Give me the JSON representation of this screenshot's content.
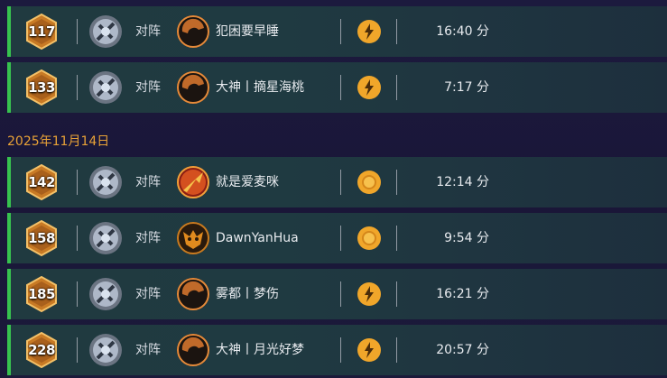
{
  "match_groups": [
    {
      "date": "",
      "matches": [
        {
          "level": "117",
          "vs": "对阵",
          "opponent": "犯困要早睡",
          "opponent_icon": "dark-swirl-avatar-icon",
          "result_icon": "flame-badge-icon",
          "duration": "16:40 分"
        },
        {
          "level": "133",
          "vs": "对阵",
          "opponent": "大神丨摘星海桃",
          "opponent_icon": "dark-swirl-avatar-icon",
          "result_icon": "flame-badge-icon",
          "duration": "7:17 分"
        }
      ]
    },
    {
      "date": "2025年11月14日",
      "matches": [
        {
          "level": "142",
          "vs": "对阵",
          "opponent": "就是爱麦咪",
          "opponent_icon": "red-dragon-avatar-icon",
          "result_icon": "coin-badge-icon",
          "duration": "12:14 分"
        },
        {
          "level": "158",
          "vs": "对阵",
          "opponent": "DawnYanHua",
          "opponent_icon": "orc-mask-avatar-icon",
          "result_icon": "coin-badge-icon",
          "duration": "9:54 分"
        },
        {
          "level": "185",
          "vs": "对阵",
          "opponent": "雾都丨梦伤",
          "opponent_icon": "dark-swirl-avatar-icon",
          "result_icon": "flame-badge-icon",
          "duration": "16:21 分"
        },
        {
          "level": "228",
          "vs": "对阵",
          "opponent": "大神丨月光好梦",
          "opponent_icon": "dark-swirl-avatar-icon",
          "result_icon": "flame-badge-icon",
          "duration": "20:57 分"
        }
      ]
    }
  ],
  "colors": {
    "win_bar": "#37c24f",
    "date_text": "#e8a237",
    "level_badge": "#d98a2b",
    "result_badge": "#f0a62a"
  }
}
